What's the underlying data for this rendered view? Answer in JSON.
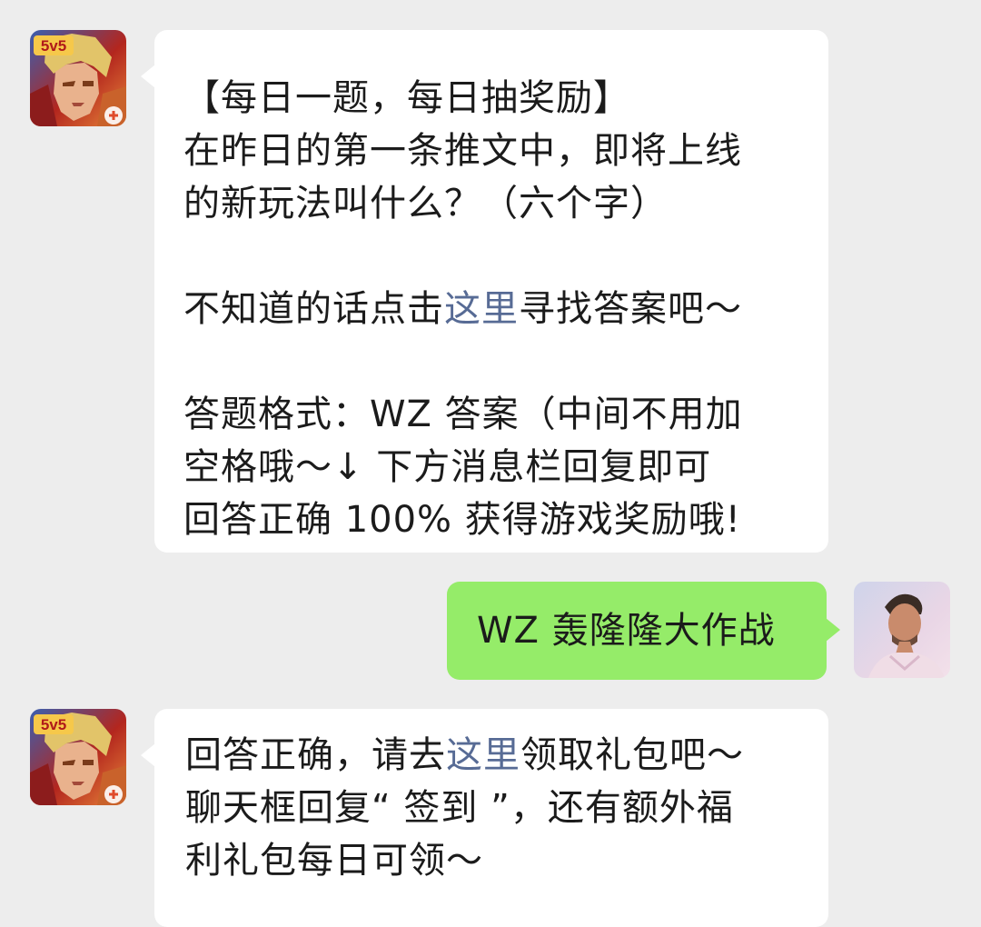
{
  "messages": [
    {
      "sender": "other",
      "avatar_icon": "honor-of-kings-hero-avatar",
      "avatar_badge": "5v5",
      "lines": {
        "l1": "【每日一题，每日抽奖励】",
        "l2": "在昨日的第一条推文中，即将上线",
        "l3": "的新玩法叫什么？（六个字）",
        "l4_prefix": "不知道的话点击",
        "l4_link": "这里",
        "l4_suffix": "寻找答案吧～",
        "l5": "答题格式：WZ 答案（中间不用加",
        "l6": "空格哦～↓ 下方消息栏回复即可",
        "l7": "回答正确 100% 获得游戏奖励哦!"
      }
    },
    {
      "sender": "self",
      "avatar_icon": "user-photo-avatar",
      "text": "WZ 轰隆隆大作战"
    },
    {
      "sender": "other",
      "avatar_icon": "honor-of-kings-hero-avatar",
      "avatar_badge": "5v5",
      "lines": {
        "l1_prefix": "回答正确，请去",
        "l1_link": "这里",
        "l1_suffix": "领取礼包吧～",
        "l2": "聊天框回复“ 签到 ”，还有额外福",
        "l3": "利礼包每日可领～"
      }
    }
  ],
  "colors": {
    "background": "#ededed",
    "bubble_other": "#ffffff",
    "bubble_self": "#95ec69",
    "link": "#576b95",
    "text": "#1b1b1b"
  }
}
